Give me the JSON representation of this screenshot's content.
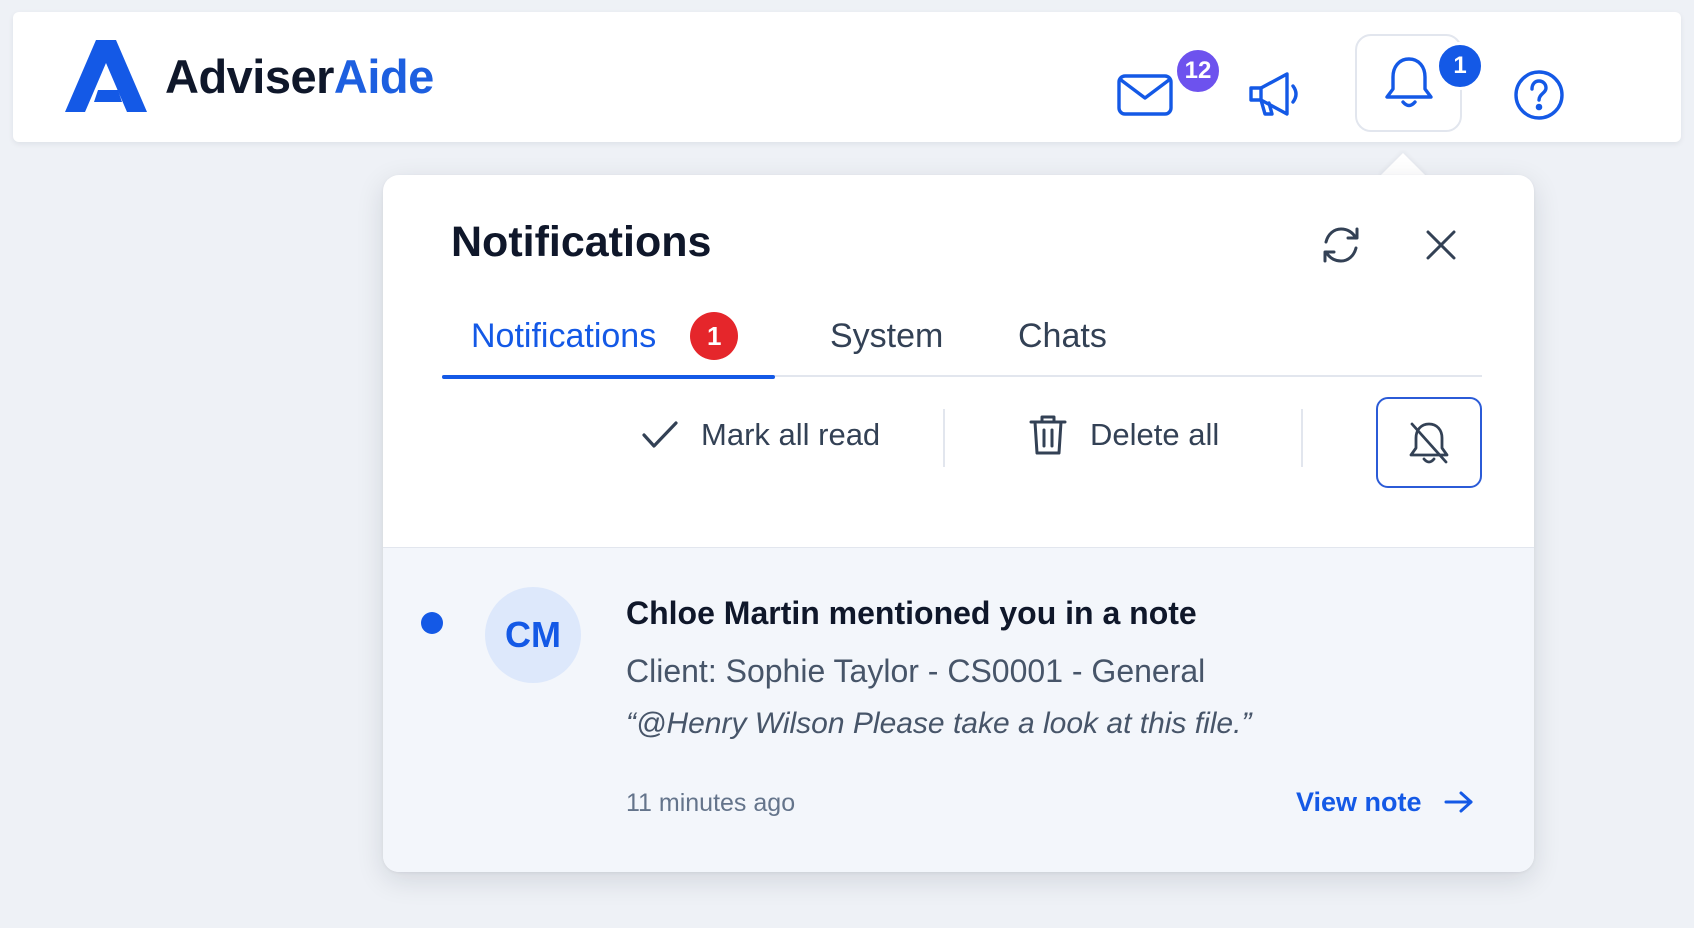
{
  "brand": {
    "name_part1": "Adviser",
    "name_part2": "Aide",
    "primary_color": "#1459e6",
    "dark_color": "#0f172a"
  },
  "header": {
    "mail": {
      "icon": "mail-icon",
      "badge": "12",
      "badge_color": "#6d52ee"
    },
    "announcements": {
      "icon": "megaphone-icon"
    },
    "notifications": {
      "icon": "bell-icon",
      "badge": "1",
      "badge_color": "#1459e6"
    },
    "help": {
      "icon": "help-icon"
    }
  },
  "panel": {
    "title": "Notifications",
    "refresh_icon": "refresh-icon",
    "close_icon": "close-icon",
    "tabs": [
      {
        "label": "Notifications",
        "badge": "1",
        "active": true
      },
      {
        "label": "System",
        "active": false
      },
      {
        "label": "Chats",
        "active": false
      }
    ],
    "actions": {
      "mark_all_read": "Mark all read",
      "delete_all": "Delete all",
      "mute_icon": "bell-off-icon"
    },
    "items": [
      {
        "unread": true,
        "avatar_initials": "CM",
        "title": "Chloe Martin mentioned you in a note",
        "client": "Client: Sophie Taylor - CS0001 - General",
        "quote": "“@Henry Wilson Please take a look at this file.”",
        "time": "11 minutes ago",
        "link_label": "View note"
      }
    ]
  }
}
